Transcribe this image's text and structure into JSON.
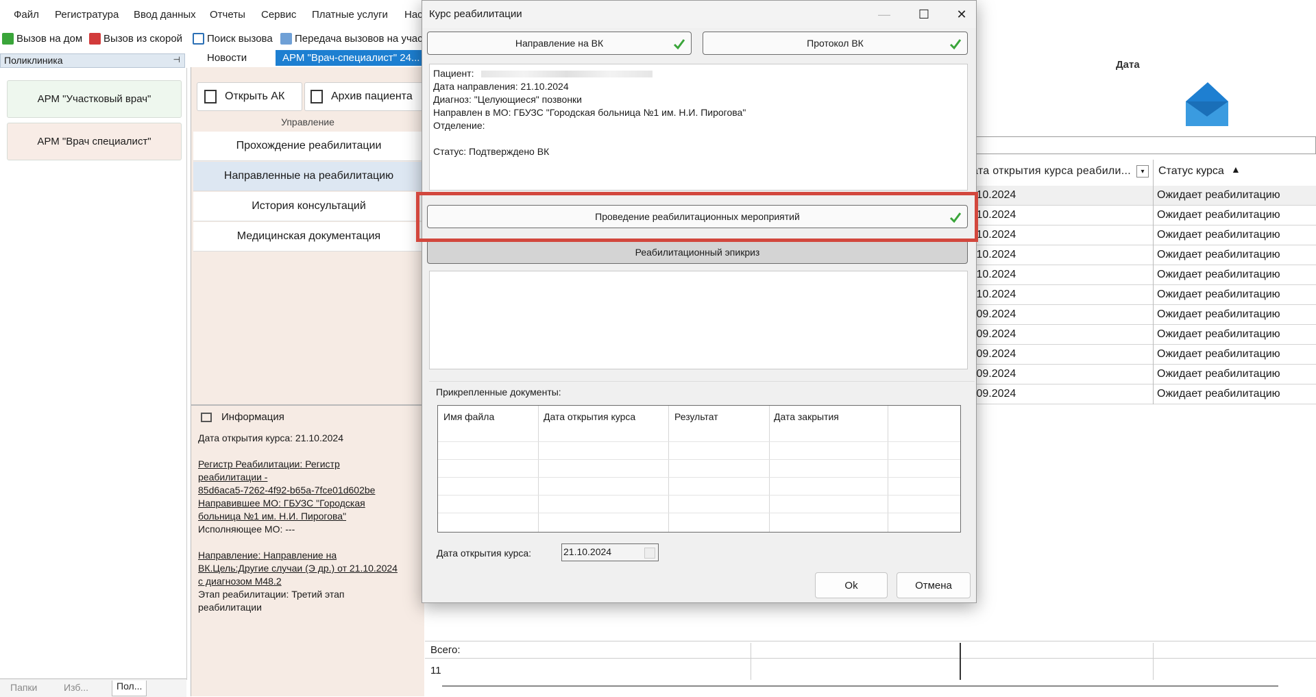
{
  "menu": [
    "Файл",
    "Регистратура",
    "Ввод данных",
    "Отчеты",
    "Сервис",
    "Платные услуги",
    "Нас"
  ],
  "toolbar": [
    {
      "label": "Вызов на дом",
      "icon": "check-icon",
      "color": "#3aa53a"
    },
    {
      "label": "Вызов из скорой",
      "icon": "ambulance-icon",
      "color": "#d23b3b"
    },
    {
      "label": "Поиск вызова",
      "icon": "search-call-icon",
      "color": "#2a6fb5"
    },
    {
      "label": "Передача вызовов на учас",
      "icon": "transfer-icon",
      "color": "#2a6fb5"
    }
  ],
  "left": {
    "header": "Поликлиника",
    "buttons": [
      "АРМ \"Участковый врач\"",
      "АРМ \"Врач специалист\""
    ],
    "tabs": [
      "Папки",
      "Изб...",
      "Пол..."
    ]
  },
  "center": {
    "tabs": [
      "Новости",
      "АРМ \"Врач-специалист\" 24..."
    ],
    "tools": [
      "Открыть АК",
      "Архив пациента"
    ],
    "group_label": "Управление",
    "nav": [
      "Прохождение реабилитации",
      "Направленные на реабилитацию",
      "История консультаций",
      "Медицинская документация"
    ],
    "info_title": "Информация",
    "info": {
      "open_date": "Дата открытия курса: 21.10.2024",
      "register_1": "Регистр Реабилитации: Регистр",
      "register_2": "реабилитации -",
      "register_3": "85d6aca5-7262-4f92-b65a-7fce01d602be",
      "mo_1": "Направившее МО: ГБУЗС \"Городская",
      "mo_2": "больница №1 им. Н.И. Пирогова\"",
      "executor": "Исполняющее МО: ---",
      "dir_1": "Направление: Направление на",
      "dir_2": "ВК.Цель:Другие случаи (Э др.) от 21.10.2024",
      "dir_3": "с диагнозом M48.2",
      "stage_1": "Этап реабилитации: Третий этап",
      "stage_2": "реабилитации"
    }
  },
  "grid": {
    "col_date_header": "ата открытия курса реабили...",
    "col_status_header": "Статус курса",
    "dates": [
      ".10.2024",
      ".10.2024",
      ".10.2024",
      ".10.2024",
      ".10.2024",
      ".10.2024",
      ".09.2024",
      ".09.2024",
      ".09.2024",
      ".09.2024",
      ".09.2024"
    ],
    "status": "Ожидает реабилитацию",
    "total_label": "Всего:",
    "total_value": "11",
    "date_filter_label": "Дата"
  },
  "dialog": {
    "title": "Курс реабилитации",
    "btn_vk": "Направление на ВК",
    "btn_protocol": "Протокол ВК",
    "patient_label": "Пациент:",
    "direction_date": "Дата направления: 21.10.2024",
    "diagnosis": "Диагноз: \"Целующиеся\" позвонки",
    "sent_to": "Направлен в МО: ГБУЗС \"Городская больница №1 им. Н.И. Пирогова\"",
    "department": "Отделение:",
    "status": "Статус: Подтверждено ВК",
    "btn_rehab": "Проведение реабилитационных мероприятий",
    "btn_epicrisis": "Реабилитационный эпикриз",
    "attached_label": "Прикрепленные документы:",
    "attached_columns": [
      "Имя файла",
      "Дата открытия курса",
      "Результат",
      "Дата закрытия"
    ],
    "open_date_label": "Дата открытия курса:",
    "open_date_value": "21.10.2024",
    "ok": "Ok",
    "cancel": "Отмена"
  }
}
